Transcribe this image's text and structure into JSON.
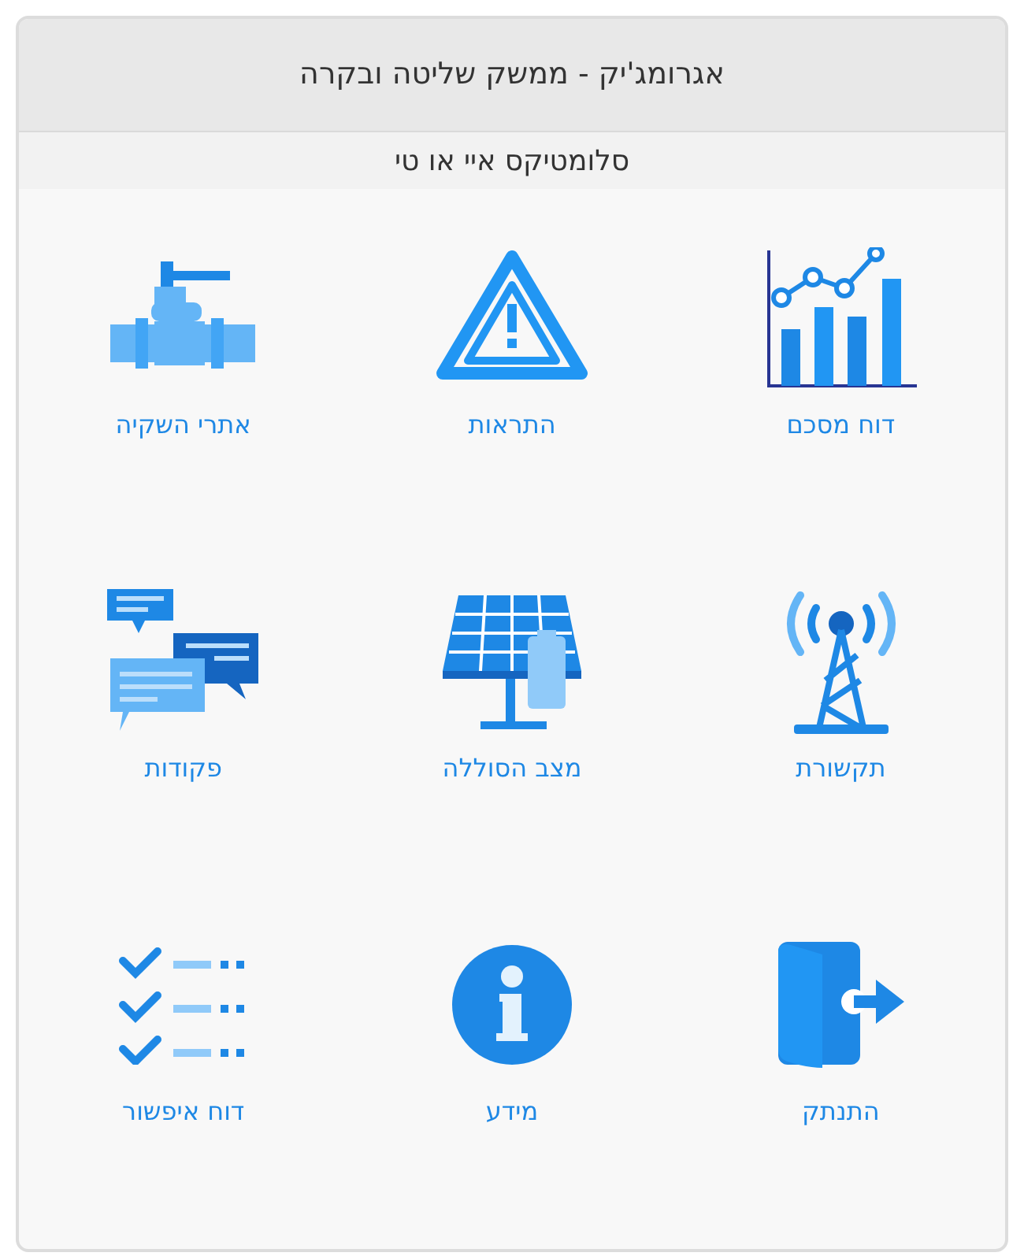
{
  "window": {
    "title": "אגרומג'יק - ממשק שליטה ובקרה"
  },
  "subtitle": "סלומטיקס איי או טי",
  "menu": [
    {
      "kind": "chart",
      "label": "דוח מסכם"
    },
    {
      "kind": "warning",
      "label": "התראות"
    },
    {
      "kind": "valve",
      "label": "אתרי השקיה"
    },
    {
      "kind": "tower",
      "label": "תקשורת"
    },
    {
      "kind": "solar",
      "label": "מצב הסוללה"
    },
    {
      "kind": "chat",
      "label": "פקודות"
    },
    {
      "kind": "logout",
      "label": "התנתק"
    },
    {
      "kind": "info",
      "label": "מידע"
    },
    {
      "kind": "checklist",
      "label": "דוח איפשור"
    }
  ]
}
